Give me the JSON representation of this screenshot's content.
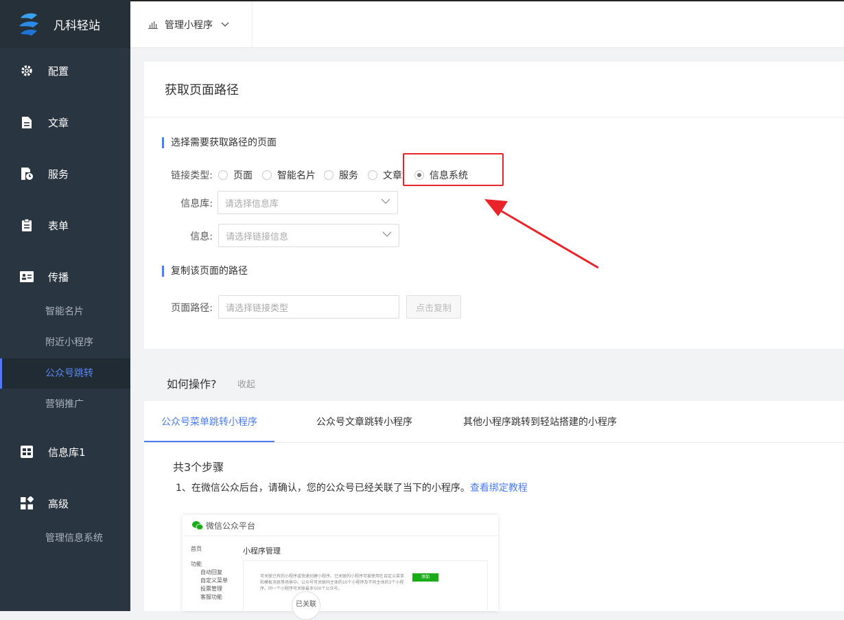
{
  "brand": {
    "name": "凡科轻站"
  },
  "topbar": {
    "selector_label": "管理小程序"
  },
  "sidebar": {
    "items": [
      {
        "label": "配置",
        "icon": "gear-icon"
      },
      {
        "label": "文章",
        "icon": "document-icon"
      },
      {
        "label": "服务",
        "icon": "service-icon"
      },
      {
        "label": "表单",
        "icon": "clipboard-icon"
      },
      {
        "label": "传播",
        "icon": "id-card-icon"
      },
      {
        "label": "信息库1",
        "icon": "grid-icon"
      },
      {
        "label": "高级",
        "icon": "blocks-icon"
      }
    ],
    "spread_sub": [
      "智能名片",
      "附近小程序",
      "公众号跳转",
      "营销推广"
    ],
    "advanced_sub": [
      "管理信息系统"
    ],
    "active_sub": "公众号跳转"
  },
  "page": {
    "title": "获取页面路径",
    "section1": "选择需要获取路径的页面",
    "link_type_label": "链接类型:",
    "link_types": [
      "页面",
      "智能名片",
      "服务",
      "文章",
      "信息系统"
    ],
    "selected_link_type": "信息系统",
    "library_label": "信息库:",
    "library_placeholder": "请选择信息库",
    "info_label": "信息:",
    "info_placeholder": "请选择链接信息",
    "section2": "复制该页面的路径",
    "path_label": "页面路径:",
    "path_placeholder": "请选择链接类型",
    "copy_button": "点击复制"
  },
  "howto": {
    "title": "如何操作?",
    "collapse": "收起",
    "tabs": [
      "公众号菜单跳转小程序",
      "公众号文章跳转小程序",
      "其他小程序跳转到轻站搭建的小程序"
    ],
    "active_tab": 0,
    "steps_title": "共3个步骤",
    "step1_text": "1、在微信公众后台，请确认，您的公众号已经关联了当下的小程序。",
    "step1_link": "查看绑定教程",
    "screenshot": {
      "platform": "微信公众平台",
      "menu": [
        "首页",
        "功能",
        "自动回复",
        "自定义菜单",
        "投票管理",
        "客服功能"
      ],
      "title": "小程序管理",
      "desc": "可关联已有的小程序或快速创建小程序。已关联的小程序可被使用在自定义菜单和模板消息等场景中。公众号可关联同主体的10个小程序及不同主体的3个小程序。同一个小程序可关联最多500个公众号。",
      "add_button": "添加",
      "linked": "已关联"
    }
  },
  "colors": {
    "accent": "#4d7cf0",
    "sidebar": "#2a3542",
    "highlight": "#e8242a"
  }
}
